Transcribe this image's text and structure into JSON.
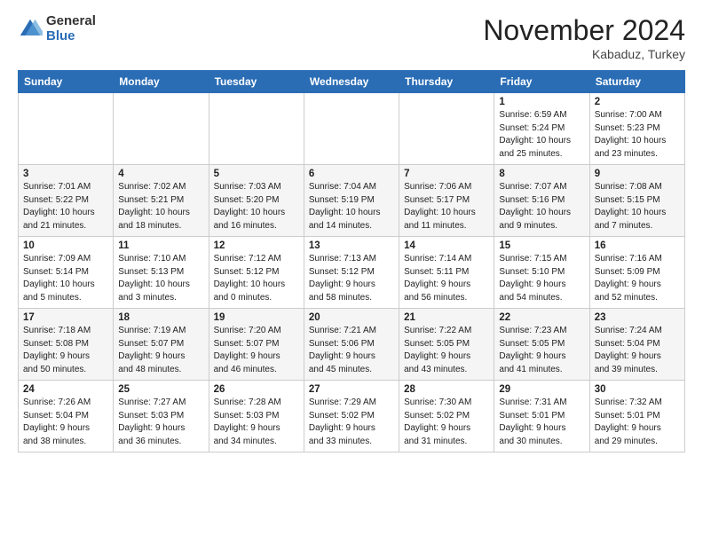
{
  "logo": {
    "general": "General",
    "blue": "Blue"
  },
  "header": {
    "month": "November 2024",
    "location": "Kabaduz, Turkey"
  },
  "weekdays": [
    "Sunday",
    "Monday",
    "Tuesday",
    "Wednesday",
    "Thursday",
    "Friday",
    "Saturday"
  ],
  "weeks": [
    [
      {
        "day": "",
        "info": ""
      },
      {
        "day": "",
        "info": ""
      },
      {
        "day": "",
        "info": ""
      },
      {
        "day": "",
        "info": ""
      },
      {
        "day": "",
        "info": ""
      },
      {
        "day": "1",
        "info": "Sunrise: 6:59 AM\nSunset: 5:24 PM\nDaylight: 10 hours\nand 25 minutes."
      },
      {
        "day": "2",
        "info": "Sunrise: 7:00 AM\nSunset: 5:23 PM\nDaylight: 10 hours\nand 23 minutes."
      }
    ],
    [
      {
        "day": "3",
        "info": "Sunrise: 7:01 AM\nSunset: 5:22 PM\nDaylight: 10 hours\nand 21 minutes."
      },
      {
        "day": "4",
        "info": "Sunrise: 7:02 AM\nSunset: 5:21 PM\nDaylight: 10 hours\nand 18 minutes."
      },
      {
        "day": "5",
        "info": "Sunrise: 7:03 AM\nSunset: 5:20 PM\nDaylight: 10 hours\nand 16 minutes."
      },
      {
        "day": "6",
        "info": "Sunrise: 7:04 AM\nSunset: 5:19 PM\nDaylight: 10 hours\nand 14 minutes."
      },
      {
        "day": "7",
        "info": "Sunrise: 7:06 AM\nSunset: 5:17 PM\nDaylight: 10 hours\nand 11 minutes."
      },
      {
        "day": "8",
        "info": "Sunrise: 7:07 AM\nSunset: 5:16 PM\nDaylight: 10 hours\nand 9 minutes."
      },
      {
        "day": "9",
        "info": "Sunrise: 7:08 AM\nSunset: 5:15 PM\nDaylight: 10 hours\nand 7 minutes."
      }
    ],
    [
      {
        "day": "10",
        "info": "Sunrise: 7:09 AM\nSunset: 5:14 PM\nDaylight: 10 hours\nand 5 minutes."
      },
      {
        "day": "11",
        "info": "Sunrise: 7:10 AM\nSunset: 5:13 PM\nDaylight: 10 hours\nand 3 minutes."
      },
      {
        "day": "12",
        "info": "Sunrise: 7:12 AM\nSunset: 5:12 PM\nDaylight: 10 hours\nand 0 minutes."
      },
      {
        "day": "13",
        "info": "Sunrise: 7:13 AM\nSunset: 5:12 PM\nDaylight: 9 hours\nand 58 minutes."
      },
      {
        "day": "14",
        "info": "Sunrise: 7:14 AM\nSunset: 5:11 PM\nDaylight: 9 hours\nand 56 minutes."
      },
      {
        "day": "15",
        "info": "Sunrise: 7:15 AM\nSunset: 5:10 PM\nDaylight: 9 hours\nand 54 minutes."
      },
      {
        "day": "16",
        "info": "Sunrise: 7:16 AM\nSunset: 5:09 PM\nDaylight: 9 hours\nand 52 minutes."
      }
    ],
    [
      {
        "day": "17",
        "info": "Sunrise: 7:18 AM\nSunset: 5:08 PM\nDaylight: 9 hours\nand 50 minutes."
      },
      {
        "day": "18",
        "info": "Sunrise: 7:19 AM\nSunset: 5:07 PM\nDaylight: 9 hours\nand 48 minutes."
      },
      {
        "day": "19",
        "info": "Sunrise: 7:20 AM\nSunset: 5:07 PM\nDaylight: 9 hours\nand 46 minutes."
      },
      {
        "day": "20",
        "info": "Sunrise: 7:21 AM\nSunset: 5:06 PM\nDaylight: 9 hours\nand 45 minutes."
      },
      {
        "day": "21",
        "info": "Sunrise: 7:22 AM\nSunset: 5:05 PM\nDaylight: 9 hours\nand 43 minutes."
      },
      {
        "day": "22",
        "info": "Sunrise: 7:23 AM\nSunset: 5:05 PM\nDaylight: 9 hours\nand 41 minutes."
      },
      {
        "day": "23",
        "info": "Sunrise: 7:24 AM\nSunset: 5:04 PM\nDaylight: 9 hours\nand 39 minutes."
      }
    ],
    [
      {
        "day": "24",
        "info": "Sunrise: 7:26 AM\nSunset: 5:04 PM\nDaylight: 9 hours\nand 38 minutes."
      },
      {
        "day": "25",
        "info": "Sunrise: 7:27 AM\nSunset: 5:03 PM\nDaylight: 9 hours\nand 36 minutes."
      },
      {
        "day": "26",
        "info": "Sunrise: 7:28 AM\nSunset: 5:03 PM\nDaylight: 9 hours\nand 34 minutes."
      },
      {
        "day": "27",
        "info": "Sunrise: 7:29 AM\nSunset: 5:02 PM\nDaylight: 9 hours\nand 33 minutes."
      },
      {
        "day": "28",
        "info": "Sunrise: 7:30 AM\nSunset: 5:02 PM\nDaylight: 9 hours\nand 31 minutes."
      },
      {
        "day": "29",
        "info": "Sunrise: 7:31 AM\nSunset: 5:01 PM\nDaylight: 9 hours\nand 30 minutes."
      },
      {
        "day": "30",
        "info": "Sunrise: 7:32 AM\nSunset: 5:01 PM\nDaylight: 9 hours\nand 29 minutes."
      }
    ]
  ]
}
